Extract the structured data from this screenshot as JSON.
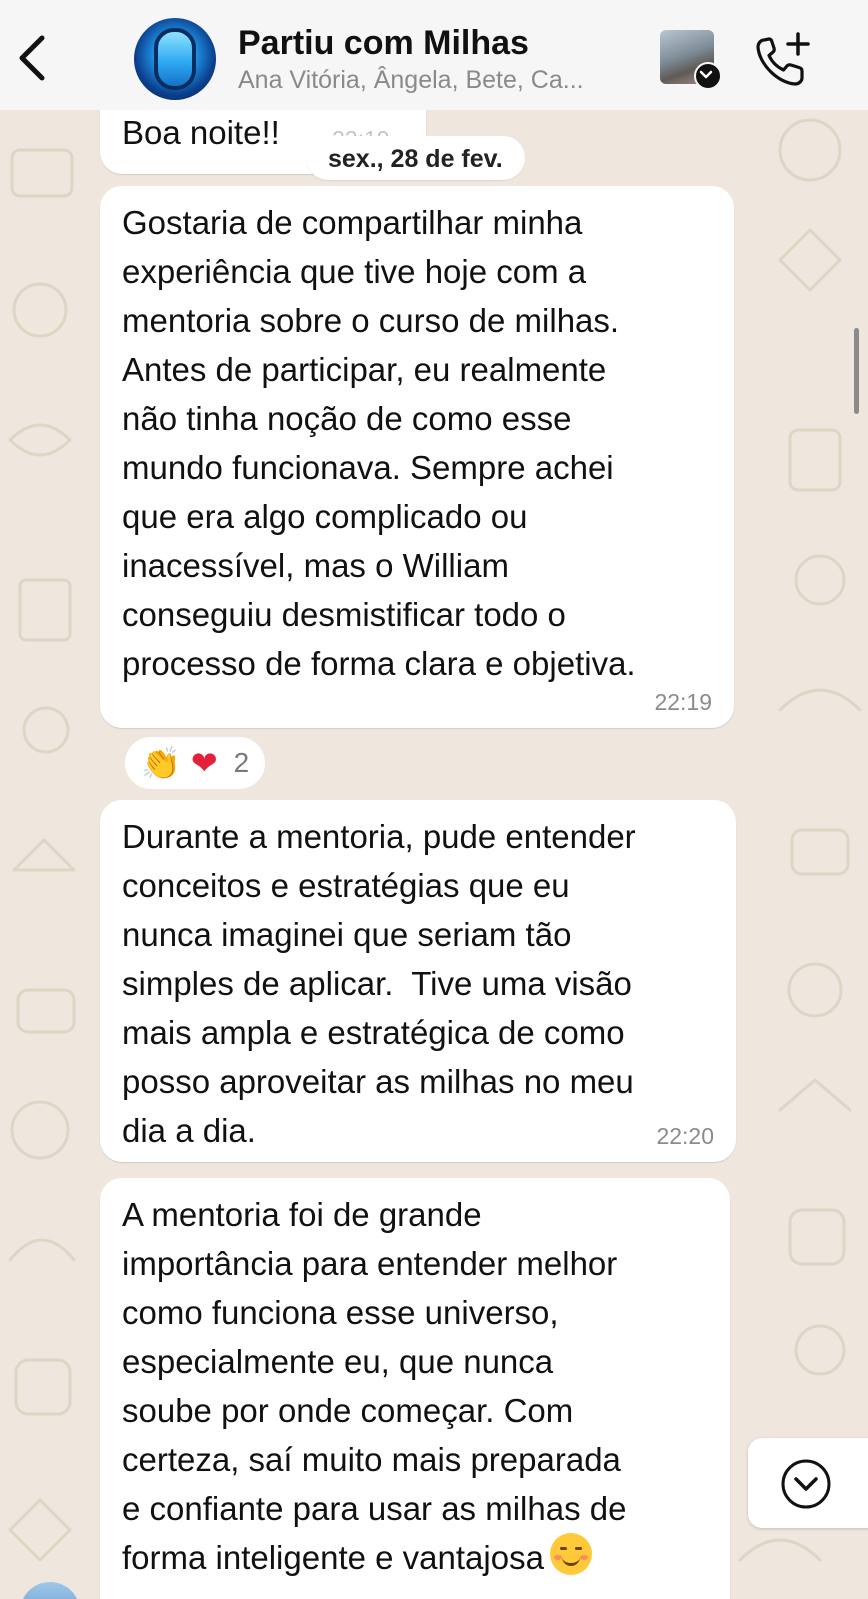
{
  "header": {
    "group_name": "Partiu com Milhas",
    "members": "Ana Vitória, Ângela, Bete, Ca..."
  },
  "chat": {
    "date_separator": "sex., 28 de fev.",
    "messages": [
      {
        "text": "Boa noite!!",
        "time": "22:19"
      },
      {
        "text": "Gostaria de compartilhar minha\nexperiência que tive hoje com a\nmentoria sobre o curso de milhas.\nAntes de participar, eu realmente\nnão tinha noção de como esse\nmundo funcionava. Sempre achei\nque era algo complicado ou\ninacessível, mas o William\nconseguiu desmistificar todo o\nprocesso de forma clara e objetiva.",
        "time": "22:19",
        "reactions": {
          "emojis": [
            "👏",
            "❤"
          ],
          "count": "2"
        }
      },
      {
        "text": "Durante a mentoria, pude entender\nconceitos e estratégias que eu\nnunca imaginei que seriam tão\nsimples de aplicar.  Tive uma visão\nmais ampla e estratégica de como\nposso aproveitar as milhas no meu\ndia a dia.",
        "time": "22:20"
      },
      {
        "text": "A mentoria foi de grande\nimportância para entender melhor\ncomo funciona esse universo,\nespecialmente eu, que nunca\nsoube por onde começar. Com\ncerteza, saí muito mais preparada\ne confiante para usar as milhas de\nforma inteligente e vantajosa",
        "emoji": "smiling-face-icon"
      }
    ]
  },
  "icons": {
    "back": "chevron-left-icon",
    "call": "phone-plus-icon",
    "scroll_down": "chevron-down-circle-icon"
  },
  "colors": {
    "wallpaper": "#efe7dd",
    "bubble": "#ffffff",
    "header": "#f6f6f6",
    "muted_text": "#8a8a8a"
  }
}
